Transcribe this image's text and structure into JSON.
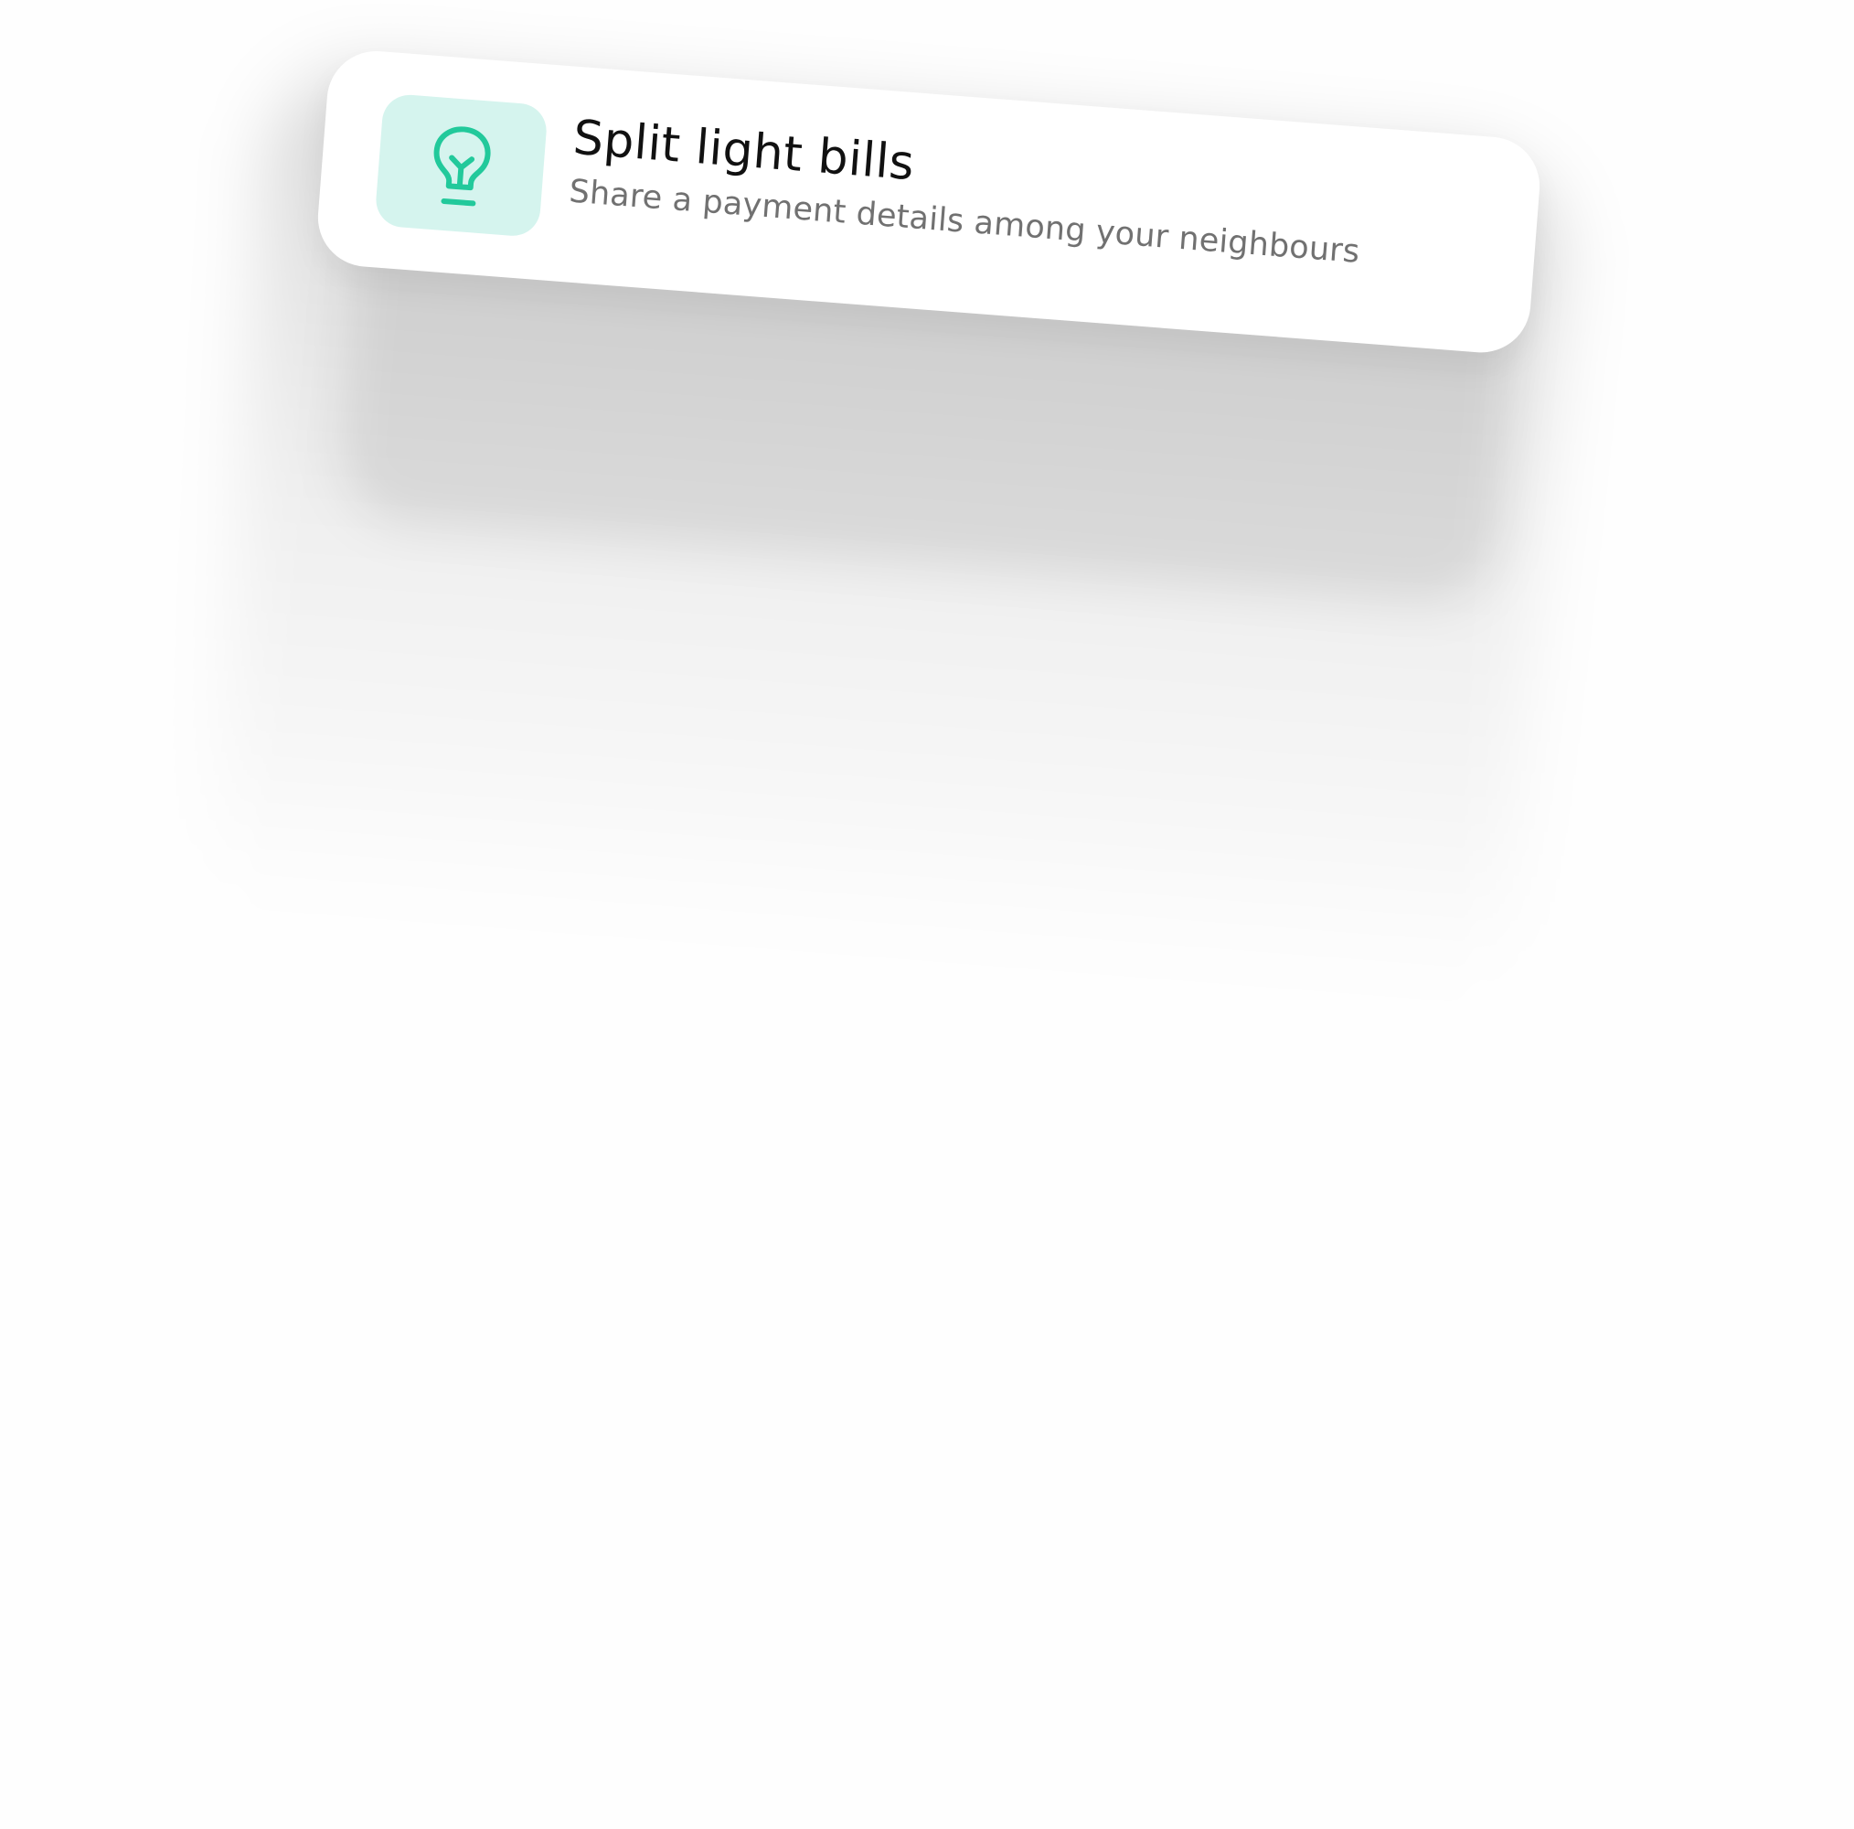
{
  "card": {
    "title": "Split light bills",
    "description": "Share a payment details among your neighbours",
    "icon": "lightbulb-icon"
  },
  "colors": {
    "background": "#fefefe",
    "card_background": "#ffffff",
    "icon_tile_background": "#d5f4ee",
    "icon_accent": "#22c99b",
    "title_text": "#111111",
    "description_text": "#717171"
  }
}
